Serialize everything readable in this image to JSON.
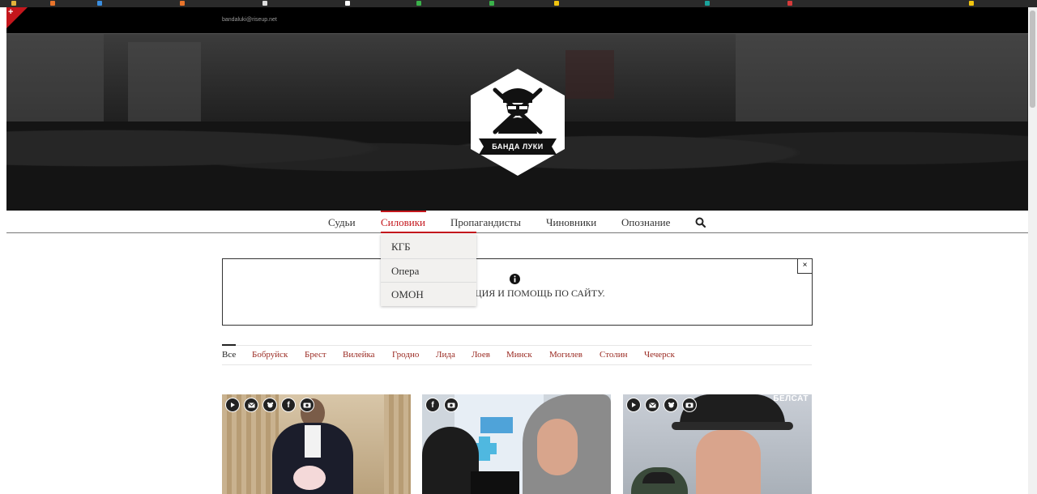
{
  "header": {
    "email": "bandaluki@riseup.net",
    "corner_icon": "plus-icon",
    "logo_text": "БАНДА ЛУКИ"
  },
  "nav": {
    "items": [
      {
        "label": "Судьи"
      },
      {
        "label": "Силовики",
        "active": true
      },
      {
        "label": "Пропагандисты"
      },
      {
        "label": "Чиновники"
      },
      {
        "label": "Опознание"
      }
    ],
    "search_icon": "search-icon"
  },
  "dropdown": {
    "items": [
      {
        "label": "КГБ"
      },
      {
        "label": "Опера"
      },
      {
        "label": "ОМОН"
      }
    ]
  },
  "notice": {
    "text": "ИНСТРУКЦИЯ И ПОМОЩЬ ПО САЙТУ.",
    "close_label": "×",
    "icon": "info-icon"
  },
  "filters": {
    "items": [
      {
        "label": "Все",
        "active": true
      },
      {
        "label": "Бобруйск"
      },
      {
        "label": "Брест"
      },
      {
        "label": "Вилейка"
      },
      {
        "label": "Гродно"
      },
      {
        "label": "Лида"
      },
      {
        "label": "Лоев"
      },
      {
        "label": "Минск"
      },
      {
        "label": "Могилев"
      },
      {
        "label": "Столин"
      },
      {
        "label": "Чечерск"
      }
    ]
  },
  "cards": [
    {
      "badges": [
        "play-icon",
        "mail-icon",
        "vk-icon",
        "facebook-icon",
        "camera-icon"
      ]
    },
    {
      "badges": [
        "facebook-icon",
        "camera-icon"
      ]
    },
    {
      "badges": [
        "play-icon",
        "mail-icon",
        "vk-icon",
        "camera-icon"
      ],
      "watermark": "БЕЛСАТ"
    }
  ],
  "colors": {
    "accent": "#c4161c",
    "filter_link": "#9a2a22",
    "topbar": "#000000"
  }
}
